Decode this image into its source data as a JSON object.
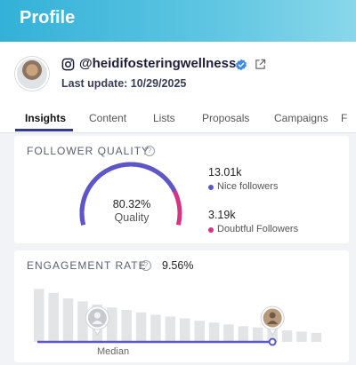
{
  "header": {
    "title": "Profile"
  },
  "profile": {
    "handle": "@heidifosteringwellness",
    "last_update": "Last update: 10/29/2025"
  },
  "tabs": [
    {
      "label": "Insights",
      "active": true
    },
    {
      "label": "Content"
    },
    {
      "label": "Lists"
    },
    {
      "label": "Proposals"
    },
    {
      "label": "Campaigns"
    },
    {
      "label": "F"
    }
  ],
  "follower_quality": {
    "title": "FOLLOWER QUALITY",
    "help": "?",
    "quality_percent": "80.32%",
    "quality_fraction": 0.8032,
    "quality_label": "Quality",
    "nice_count": "13.01k",
    "nice_label": "Nice followers",
    "doubtful_count": "3.19k",
    "doubtful_label": "Doubtful Followers",
    "colors": {
      "nice": "#5b57c8",
      "doubtful": "#d63384"
    }
  },
  "engagement": {
    "title": "ENGAGEMENT RATE",
    "help": "?",
    "value": "9.56%",
    "median_label": "Median",
    "bar_levels": [
      0.88,
      0.81,
      0.72,
      0.67,
      0.62,
      0.57,
      0.53,
      0.49,
      0.45,
      0.42,
      0.39,
      0.35,
      0.32,
      0.29,
      0.26,
      0.24,
      0.22,
      0.19,
      0.17,
      0.15
    ],
    "median_bucket": 4,
    "profile_bucket": 16,
    "colors": {
      "bar": "#e3e4e6",
      "track": "#5b57c8"
    }
  }
}
